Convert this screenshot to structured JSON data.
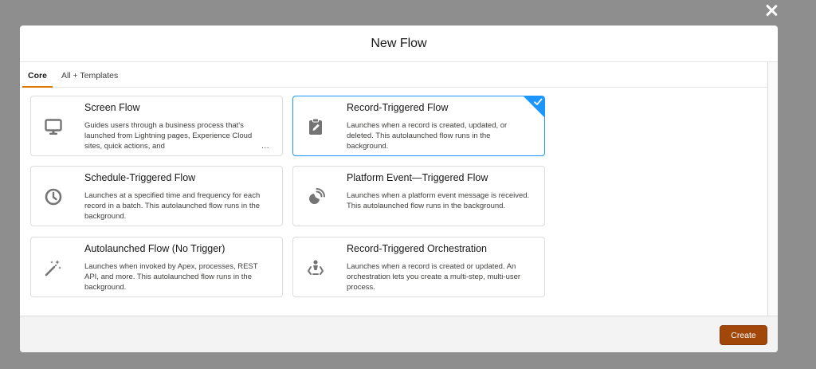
{
  "modal": {
    "title": "New Flow"
  },
  "tabs": [
    {
      "label": "Core",
      "active": true
    },
    {
      "label": "All + Templates",
      "active": false
    }
  ],
  "cards": [
    {
      "title": "Screen Flow",
      "description": "Guides users through a business process that's launched from Lightning pages, Experience Cloud sites, quick actions, and",
      "more": "...",
      "icon": "monitor-icon",
      "selected": false
    },
    {
      "title": "Record-Triggered Flow",
      "description": "Launches when a record is created, updated, or deleted. This autolaunched flow runs in the background.",
      "icon": "clipboard-edit-icon",
      "selected": true
    },
    {
      "title": "Schedule-Triggered Flow",
      "description": "Launches at a specified time and frequency for each record in a batch. This autolaunched flow runs in the background.",
      "icon": "clock-icon",
      "selected": false
    },
    {
      "title": "Platform Event—Triggered Flow",
      "description": "Launches when a platform event message is received. This autolaunched flow runs in the background.",
      "icon": "broadcast-icon",
      "selected": false
    },
    {
      "title": "Autolaunched Flow (No Trigger)",
      "description": "Launches when invoked by Apex, processes, REST API, and more. This autolaunched flow runs in the background.",
      "icon": "magic-wand-icon",
      "selected": false
    },
    {
      "title": "Record-Triggered Orchestration",
      "description": "Launches when a record is created or updated. An orchestration lets you create a multi-step, multi-user process.",
      "icon": "orchestration-icon",
      "selected": false
    }
  ],
  "footer": {
    "create_label": "Create"
  },
  "colors": {
    "overlay": "#8e8e8e",
    "accent_tab": "#dd7a01",
    "selected_border": "#1b96ff",
    "create_button": "#a2470a",
    "icon": "#747474"
  }
}
